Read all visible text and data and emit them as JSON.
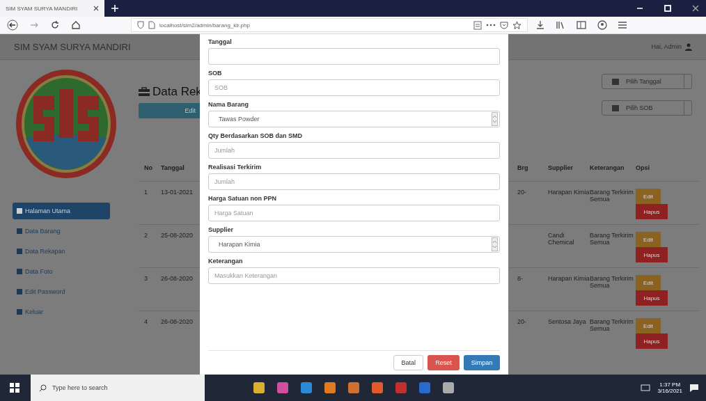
{
  "browser": {
    "tab_title": "SIM SYAM SURYA MANDIRI",
    "url": "localhost/sim2/admin/barang_klr.php"
  },
  "header": {
    "brand": "SIM SYAM SURYA MANDIRI",
    "user": "Hai, Admin"
  },
  "sidebar": [
    {
      "label": "Halaman Utama",
      "selected": true
    },
    {
      "label": "Data Barang",
      "selected": false
    },
    {
      "label": "Data Rekapan",
      "selected": false
    },
    {
      "label": "Data Foto",
      "selected": false
    },
    {
      "label": "Edit Password",
      "selected": false
    },
    {
      "label": "Keluar",
      "selected": false
    }
  ],
  "main": {
    "title": "Data Rek",
    "add_button": "Edit",
    "filters": [
      "Pilih Tanggal",
      "Pilih SOB"
    ]
  },
  "table": {
    "columns": [
      "No",
      "Tanggal",
      "Brg",
      "Supplier",
      "Keterangan",
      "Opsi"
    ],
    "rows": [
      {
        "no": "1",
        "tanggal": "13-01-2021",
        "brg": "20-",
        "supplier": "Harapan Kimia",
        "keterangan": "Barang Terkirim Semua",
        "edit": "Edit",
        "delete": "Hapus"
      },
      {
        "no": "2",
        "tanggal": "25-08-2020",
        "brg": "",
        "supplier": "Candi Chemical",
        "keterangan": "Barang Terkirim Semua",
        "edit": "Edit",
        "delete": "Hapus"
      },
      {
        "no": "3",
        "tanggal": "26-08-2020",
        "brg": "8-",
        "supplier": "Harapan Kimia",
        "keterangan": "Barang Terkirim Semua",
        "edit": "Edit",
        "delete": "Hapus"
      },
      {
        "no": "4",
        "tanggal": "26-08-2020",
        "brg": "20-",
        "supplier": "Sentosa Jaya",
        "keterangan": "Barang Terkirim Semua",
        "edit": "Edit",
        "delete": "Hapus"
      }
    ]
  },
  "modal": {
    "fields": [
      {
        "label": "Tanggal",
        "kind": "input"
      },
      {
        "label": "SOB",
        "kind": "input",
        "placeholder": "SOB"
      },
      {
        "label": "Nama Barang",
        "kind": "select",
        "value": "Tawas Powder"
      },
      {
        "label": "Qty Berdasarkan SOB dan SMD",
        "kind": "input",
        "placeholder": "Jumlah"
      },
      {
        "label": "Realisasi Terkirim",
        "kind": "input",
        "placeholder": "Jumlah"
      },
      {
        "label": "Harga Satuan non PPN",
        "kind": "input",
        "placeholder": "Harga Satuan"
      },
      {
        "label": "Supplier",
        "kind": "select",
        "value": "Harapan Kimia"
      },
      {
        "label": "Keterangan",
        "kind": "input",
        "placeholder": "Masukkan Keterangan"
      }
    ],
    "buttons": [
      {
        "label": "Batal",
        "kind": "default"
      },
      {
        "label": "Reset",
        "kind": "danger"
      },
      {
        "label": "Simpan",
        "kind": "primary"
      }
    ]
  },
  "taskbar": {
    "search_placeholder": "Type here to search",
    "time": "1:37 PM",
    "date": "3/16/2021"
  }
}
